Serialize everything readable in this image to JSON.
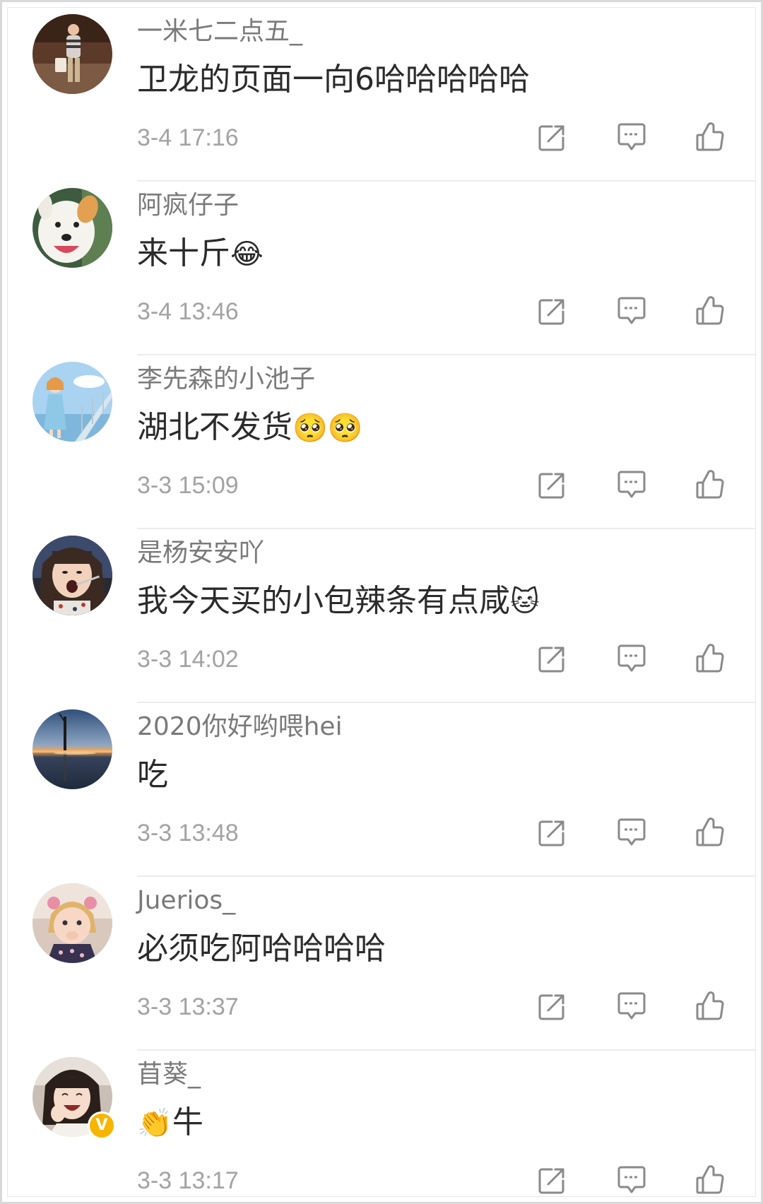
{
  "comments": [
    {
      "username": "一米七二点五_",
      "message": "卫龙的页面一向6哈哈哈哈哈",
      "emoji": "",
      "timestamp": "3-4 17:16",
      "avatar_icon": "woman-standing-avatar",
      "verified": false
    },
    {
      "username": "阿疯仔子",
      "message": "来十斤",
      "emoji": "😂",
      "timestamp": "3-4 13:46",
      "avatar_icon": "white-dog-avatar",
      "verified": false
    },
    {
      "username": "李先森的小池子",
      "message": "湖北不发货",
      "emoji": "🥺🥺",
      "timestamp": "3-3 15:09",
      "avatar_icon": "anime-girl-bridge-avatar",
      "verified": false
    },
    {
      "username": "是杨安安吖",
      "message": "我今天买的小包辣条有点咸",
      "emoji": "🐱",
      "timestamp": "3-3 14:02",
      "avatar_icon": "girl-eating-avatar",
      "verified": false
    },
    {
      "username": "2020你好哟喂hei",
      "message": "吃",
      "emoji": "",
      "timestamp": "3-3 13:48",
      "avatar_icon": "sunset-lake-avatar",
      "verified": false
    },
    {
      "username": "Juerios_",
      "message": "必须吃阿哈哈哈哈",
      "emoji": "",
      "timestamp": "3-3 13:37",
      "avatar_icon": "surprised-child-avatar",
      "verified": false
    },
    {
      "username": "苜葵_",
      "message": "牛",
      "emoji": "👏",
      "timestamp": "3-3 13:17",
      "avatar_icon": "laughing-girl-avatar",
      "verified": true,
      "verified_badge": "V"
    }
  ],
  "actions": {
    "share_icon": "share-icon",
    "comment_icon": "comment-icon",
    "like_icon": "thumbs-up-icon"
  },
  "colors": {
    "username": "#7a7a7a",
    "message": "#2b2b2b",
    "timestamp": "#a3a3a3",
    "icon": "#8a8a8a",
    "divider": "#ececec",
    "verified_badge": "#f7b500"
  }
}
